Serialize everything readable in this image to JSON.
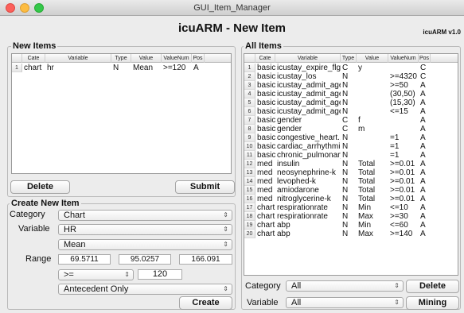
{
  "window": {
    "title": "GUI_Item_Manager"
  },
  "app": {
    "title": "icuARM - New Item",
    "version": "icuARM v1.0"
  },
  "new_items": {
    "title": "New Items",
    "columns": [
      "Cate",
      "Variable",
      "Type",
      "Value",
      "ValueNum",
      "Pos"
    ],
    "rows": [
      {
        "num": "1",
        "cate": "chart",
        "variable": "hr",
        "type": "N",
        "value": "Mean",
        "valuenum": ">=120",
        "pos": "A"
      }
    ],
    "delete_label": "Delete",
    "submit_label": "Submit"
  },
  "create": {
    "title": "Create New Item",
    "category_label": "Category",
    "category_value": "Chart",
    "variable_label": "Variable",
    "variable_value": "HR",
    "stat_value": "Mean",
    "range_label": "Range",
    "range_min": "69.5711",
    "range_mid": "95.0257",
    "range_max": "166.091",
    "operator_value": ">=",
    "threshold_value": "120",
    "position_value": "Antecedent Only",
    "create_label": "Create"
  },
  "all_items": {
    "title": "All Items",
    "columns": [
      "Cate",
      "Variable",
      "Type",
      "Value",
      "ValueNum",
      "Pos"
    ],
    "rows": [
      {
        "num": "1",
        "cate": "basic",
        "variable": "icustay_expire_flg",
        "type": "C",
        "value": "y",
        "valuenum": "",
        "pos": "C"
      },
      {
        "num": "2",
        "cate": "basic",
        "variable": "icustay_los",
        "type": "N",
        "value": "",
        "valuenum": ">=4320",
        "pos": "C"
      },
      {
        "num": "3",
        "cate": "basic",
        "variable": "icustay_admit_age",
        "type": "N",
        "value": "",
        "valuenum": ">=50",
        "pos": "A"
      },
      {
        "num": "4",
        "cate": "basic",
        "variable": "icustay_admit_age",
        "type": "N",
        "value": "",
        "valuenum": "(30,50)",
        "pos": "A"
      },
      {
        "num": "5",
        "cate": "basic",
        "variable": "icustay_admit_age",
        "type": "N",
        "value": "",
        "valuenum": "(15,30)",
        "pos": "A"
      },
      {
        "num": "6",
        "cate": "basic",
        "variable": "icustay_admit_age",
        "type": "N",
        "value": "",
        "valuenum": "<=15",
        "pos": "A"
      },
      {
        "num": "7",
        "cate": "basic",
        "variable": "gender",
        "type": "C",
        "value": "f",
        "valuenum": "",
        "pos": "A"
      },
      {
        "num": "8",
        "cate": "basic",
        "variable": "gender",
        "type": "C",
        "value": "m",
        "valuenum": "",
        "pos": "A"
      },
      {
        "num": "9",
        "cate": "basic",
        "variable": "congestive_heart...",
        "type": "N",
        "value": "",
        "valuenum": "=1",
        "pos": "A"
      },
      {
        "num": "10",
        "cate": "basic",
        "variable": "cardiac_arrhythmi...",
        "type": "N",
        "value": "",
        "valuenum": "=1",
        "pos": "A"
      },
      {
        "num": "11",
        "cate": "basic",
        "variable": "chronic_pulmonary",
        "type": "N",
        "value": "",
        "valuenum": "=1",
        "pos": "A"
      },
      {
        "num": "12",
        "cate": "med",
        "variable": "insulin",
        "type": "N",
        "value": "Total",
        "valuenum": ">=0.01",
        "pos": "A"
      },
      {
        "num": "13",
        "cate": "med",
        "variable": "neosynephrine-k",
        "type": "N",
        "value": "Total",
        "valuenum": ">=0.01",
        "pos": "A"
      },
      {
        "num": "14",
        "cate": "med",
        "variable": "levophed-k",
        "type": "N",
        "value": "Total",
        "valuenum": ">=0.01",
        "pos": "A"
      },
      {
        "num": "15",
        "cate": "med",
        "variable": "amiodarone",
        "type": "N",
        "value": "Total",
        "valuenum": ">=0.01",
        "pos": "A"
      },
      {
        "num": "16",
        "cate": "med",
        "variable": "nitroglycerine-k",
        "type": "N",
        "value": "Total",
        "valuenum": ">=0.01",
        "pos": "A"
      },
      {
        "num": "17",
        "cate": "chart",
        "variable": "respirationrate",
        "type": "N",
        "value": "Min",
        "valuenum": "<=10",
        "pos": "A"
      },
      {
        "num": "18",
        "cate": "chart",
        "variable": "respirationrate",
        "type": "N",
        "value": "Max",
        "valuenum": ">=30",
        "pos": "A"
      },
      {
        "num": "19",
        "cate": "chart",
        "variable": "abp",
        "type": "N",
        "value": "Min",
        "valuenum": "<=60",
        "pos": "A"
      },
      {
        "num": "20",
        "cate": "chart",
        "variable": "abp",
        "type": "N",
        "value": "Max",
        "valuenum": ">=140",
        "pos": "A"
      }
    ],
    "category_label": "Category",
    "category_value": "All",
    "variable_label": "Variable",
    "variable_value": "All",
    "delete_label": "Delete",
    "mining_label": "Mining"
  }
}
